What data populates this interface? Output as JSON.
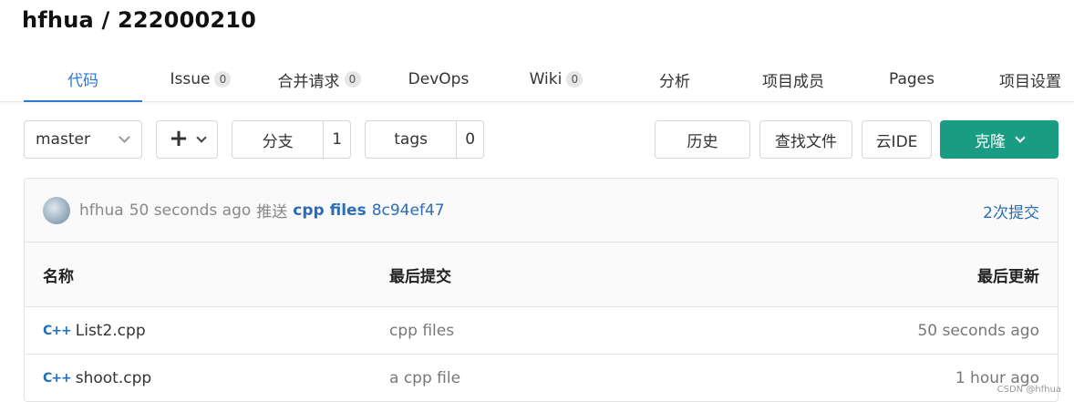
{
  "repo": {
    "title": "hfhua / 222000210"
  },
  "tabs": [
    {
      "label": "代码",
      "active": true
    },
    {
      "label": "Issue",
      "badge": "0"
    },
    {
      "label": "合并请求",
      "badge": "0"
    },
    {
      "label": "DevOps"
    },
    {
      "label": "Wiki",
      "badge": "0"
    },
    {
      "label": "分析"
    },
    {
      "label": "项目成员"
    },
    {
      "label": "Pages"
    },
    {
      "label": "项目设置"
    }
  ],
  "toolbar": {
    "branch": "master",
    "branches_label": "分支",
    "branches_count": "1",
    "tags_label": "tags",
    "tags_count": "0",
    "history_label": "历史",
    "find_file_label": "查找文件",
    "cloud_ide_label": "云IDE",
    "clone_label": "克隆"
  },
  "commit": {
    "author": "hfhua",
    "time": "50 seconds ago",
    "action": "推送",
    "message": "cpp files",
    "hash": "8c94ef47",
    "count_label": "2次提交"
  },
  "table": {
    "headers": [
      "名称",
      "最后提交",
      "最后更新"
    ],
    "rows": [
      {
        "icon": "cpp-file-icon",
        "name": "List2.cpp",
        "last_commit": "cpp files",
        "updated": "50 seconds ago"
      },
      {
        "icon": "cpp-file-icon",
        "name": "shoot.cpp",
        "last_commit": "a cpp file",
        "updated": "1 hour ago"
      }
    ]
  },
  "colors": {
    "accent": "#2c7ad6",
    "clone_button": "#1a9c83",
    "link": "#2c6db5"
  },
  "watermark": "CSDN @hfhua"
}
